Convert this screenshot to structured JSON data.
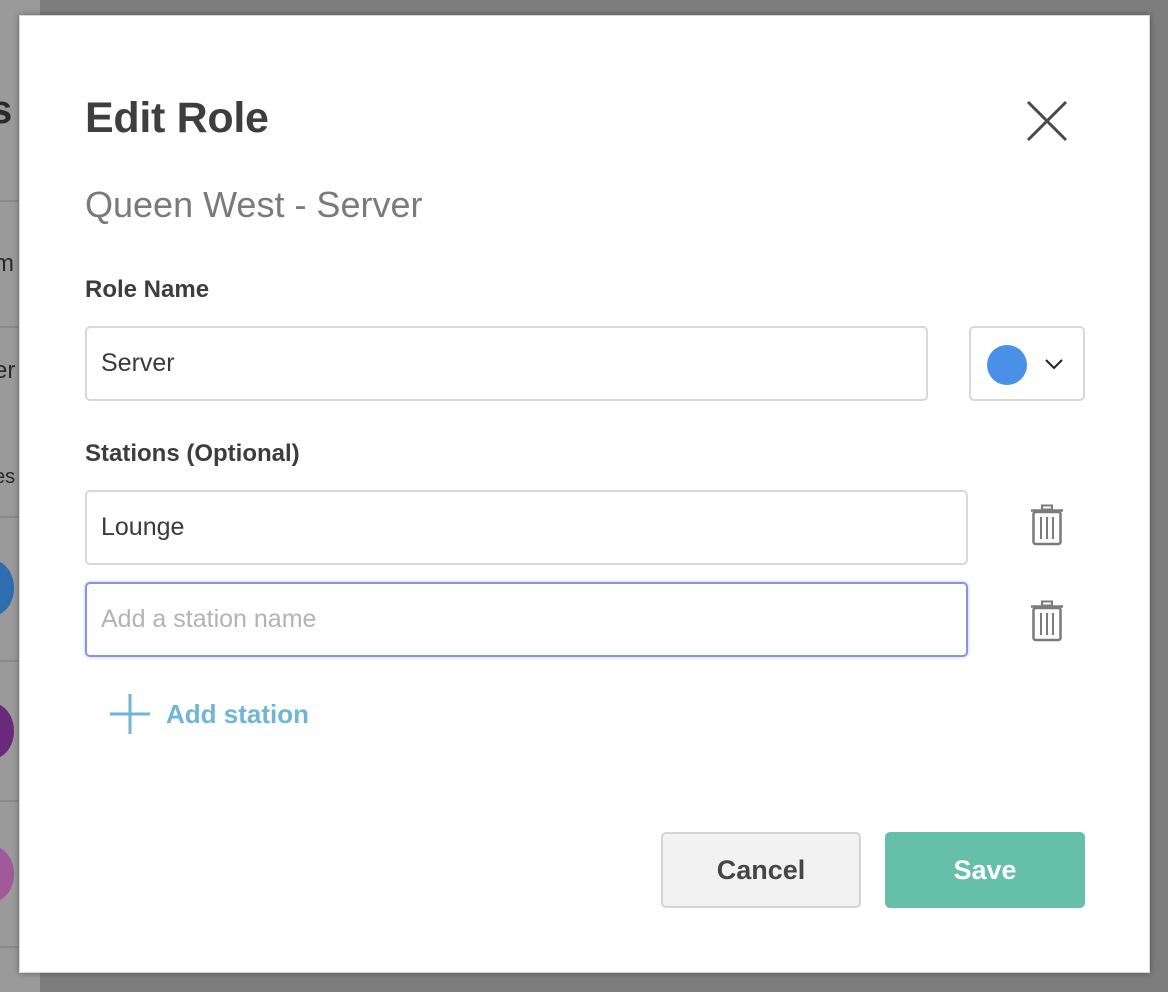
{
  "background": {
    "fragments": [
      "s",
      "m",
      "er",
      "es"
    ]
  },
  "dialog": {
    "title": "Edit Role",
    "subtitle": "Queen West - Server",
    "role_name_label": "Role Name",
    "role_name_value": "Server",
    "role_color": "#4a90e8",
    "stations_label": "Stations (Optional)",
    "stations": [
      {
        "value": "Lounge",
        "placeholder": ""
      },
      {
        "value": "",
        "placeholder": "Add a station name"
      }
    ],
    "add_station_label": "Add station",
    "cancel_label": "Cancel",
    "save_label": "Save"
  },
  "colors": {
    "save_button": "#66bfa9",
    "add_station_text": "#6fb6d6",
    "focus_border": "#8b93e0"
  },
  "icons": {
    "close": "close-icon",
    "chevron": "chevron-down-icon",
    "delete": "trash-icon",
    "add": "plus-icon"
  }
}
